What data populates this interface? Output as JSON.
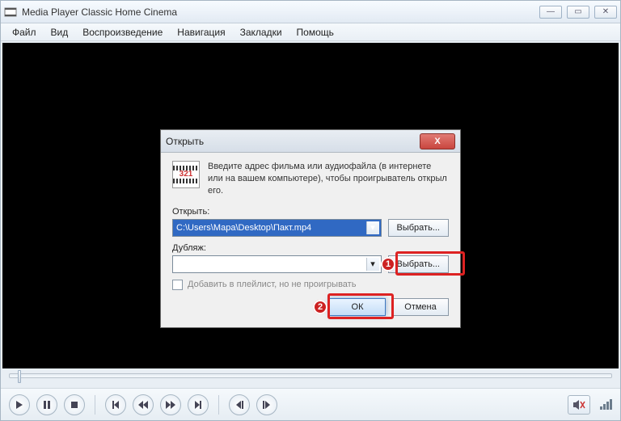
{
  "main_window": {
    "title": "Media Player Classic Home Cinema",
    "menu": [
      "Файл",
      "Вид",
      "Воспроизведение",
      "Навигация",
      "Закладки",
      "Помощь"
    ]
  },
  "dialog": {
    "title": "Открыть",
    "instruction": "Введите адрес фильма или аудиофайла (в интернете или на вашем компьютере), чтобы проигрыватель открыл его.",
    "field_open_label": "Открыть:",
    "field_open_value": "C:\\Users\\Мара\\Desktop\\Пакт.mp4",
    "browse1": "Выбрать...",
    "field_dub_label": "Дубляж:",
    "field_dub_value": "",
    "browse2": "Выбрать...",
    "checkbox_label": "Добавить в плейлист, но не проигрывать",
    "ok": "ОК",
    "cancel": "Отмена",
    "icon_text": "321"
  },
  "annotations": {
    "badge1": "1",
    "badge2": "2"
  }
}
